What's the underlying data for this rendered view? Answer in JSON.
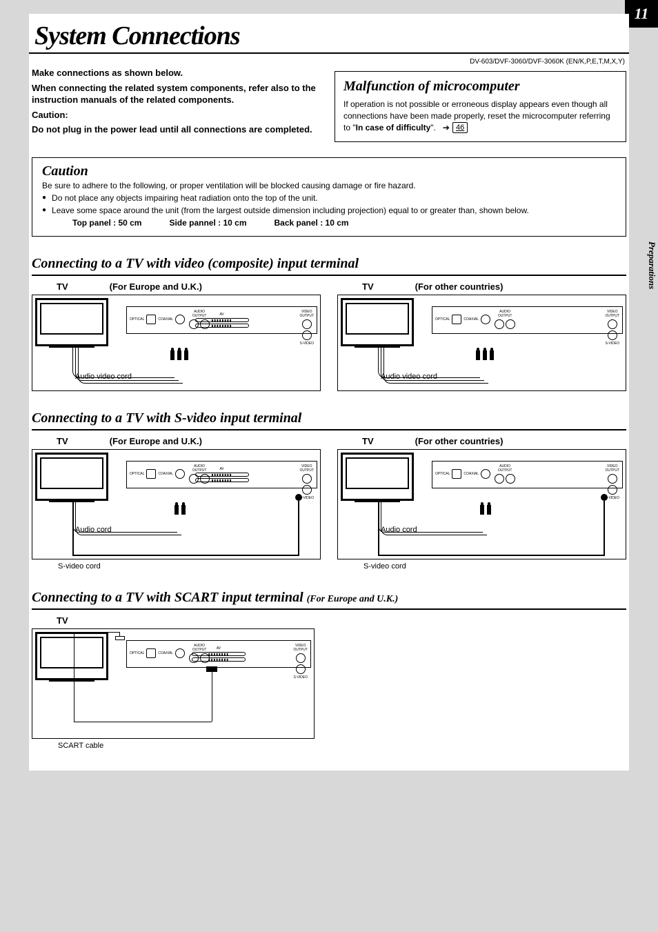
{
  "page_number": "11",
  "side_tab": "Preparations",
  "title": "System Connections",
  "model_line": "DV-603/DVF-3060/DVF-3060K (EN/K,P,E,T,M,X,Y)",
  "intro": {
    "line1": "Make connections as shown below.",
    "line2": "When connecting the related system components, refer also to the instruction manuals of the related components.",
    "caution_label": "Caution:",
    "caution_text": "Do not plug in the power lead until all connections are completed."
  },
  "malfunction": {
    "title": "Malfunction of microcomputer",
    "body_pre": "If operation is not possible or erroneous display appears even though all connections have been made properly, reset the microcomputer referring to \"",
    "body_bold": "In case of difficulty",
    "body_post": "\".",
    "page_ref": "46"
  },
  "caution_box": {
    "title": "Caution",
    "lead": "Be sure to adhere to the following, or proper ventilation will be blocked causing damage or fire hazard.",
    "bullet1": "Do not place any objects impairing heat radiation onto the top of the unit.",
    "bullet2": "Leave some space around the unit (from the largest outside dimension including projection) equal to or greater than, shown below.",
    "spacing": {
      "top": "Top panel : 50 cm",
      "side": "Side pannel : 10 cm",
      "back": "Back panel : 10 cm"
    }
  },
  "section_composite": {
    "title": "Connecting to a TV with video (composite) input terminal",
    "tv_label": "TV",
    "region_eu": "(For Europe and U.K.)",
    "region_other": "(For other countries)",
    "cord_label": "Audio video cord"
  },
  "section_svideo": {
    "title": "Connecting to a TV with S-video input terminal",
    "tv_label": "TV",
    "region_eu": "(For Europe and U.K.)",
    "region_other": "(For other countries)",
    "audio_cord": "Audio cord",
    "svideo_cord": "S-video cord"
  },
  "section_scart": {
    "title_main": "Connecting to a TV with SCART input terminal",
    "title_sub": "(For Europe and U.K.)",
    "tv_label": "TV",
    "cable_label": "SCART cable"
  }
}
